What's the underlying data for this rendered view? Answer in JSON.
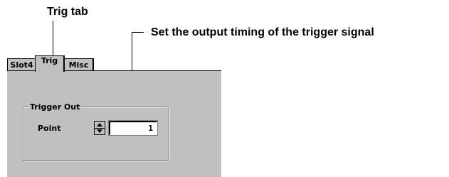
{
  "annotations": {
    "trig_tab": "Trig tab",
    "output_timing": "Set the output timing of the trigger signal"
  },
  "tabs": [
    {
      "label": "Slot4",
      "active": false
    },
    {
      "label": "Trig",
      "active": true
    },
    {
      "label": "Misc",
      "active": false
    }
  ],
  "trigger_out": {
    "group_title": "Trigger Out",
    "point_label": "Point",
    "point_value": "1"
  },
  "colors": {
    "panel_background": "#c0c0c0",
    "input_background": "#ffffff"
  },
  "icons": {
    "spin_up": "triangle-up-icon",
    "spin_down": "triangle-down-icon"
  }
}
